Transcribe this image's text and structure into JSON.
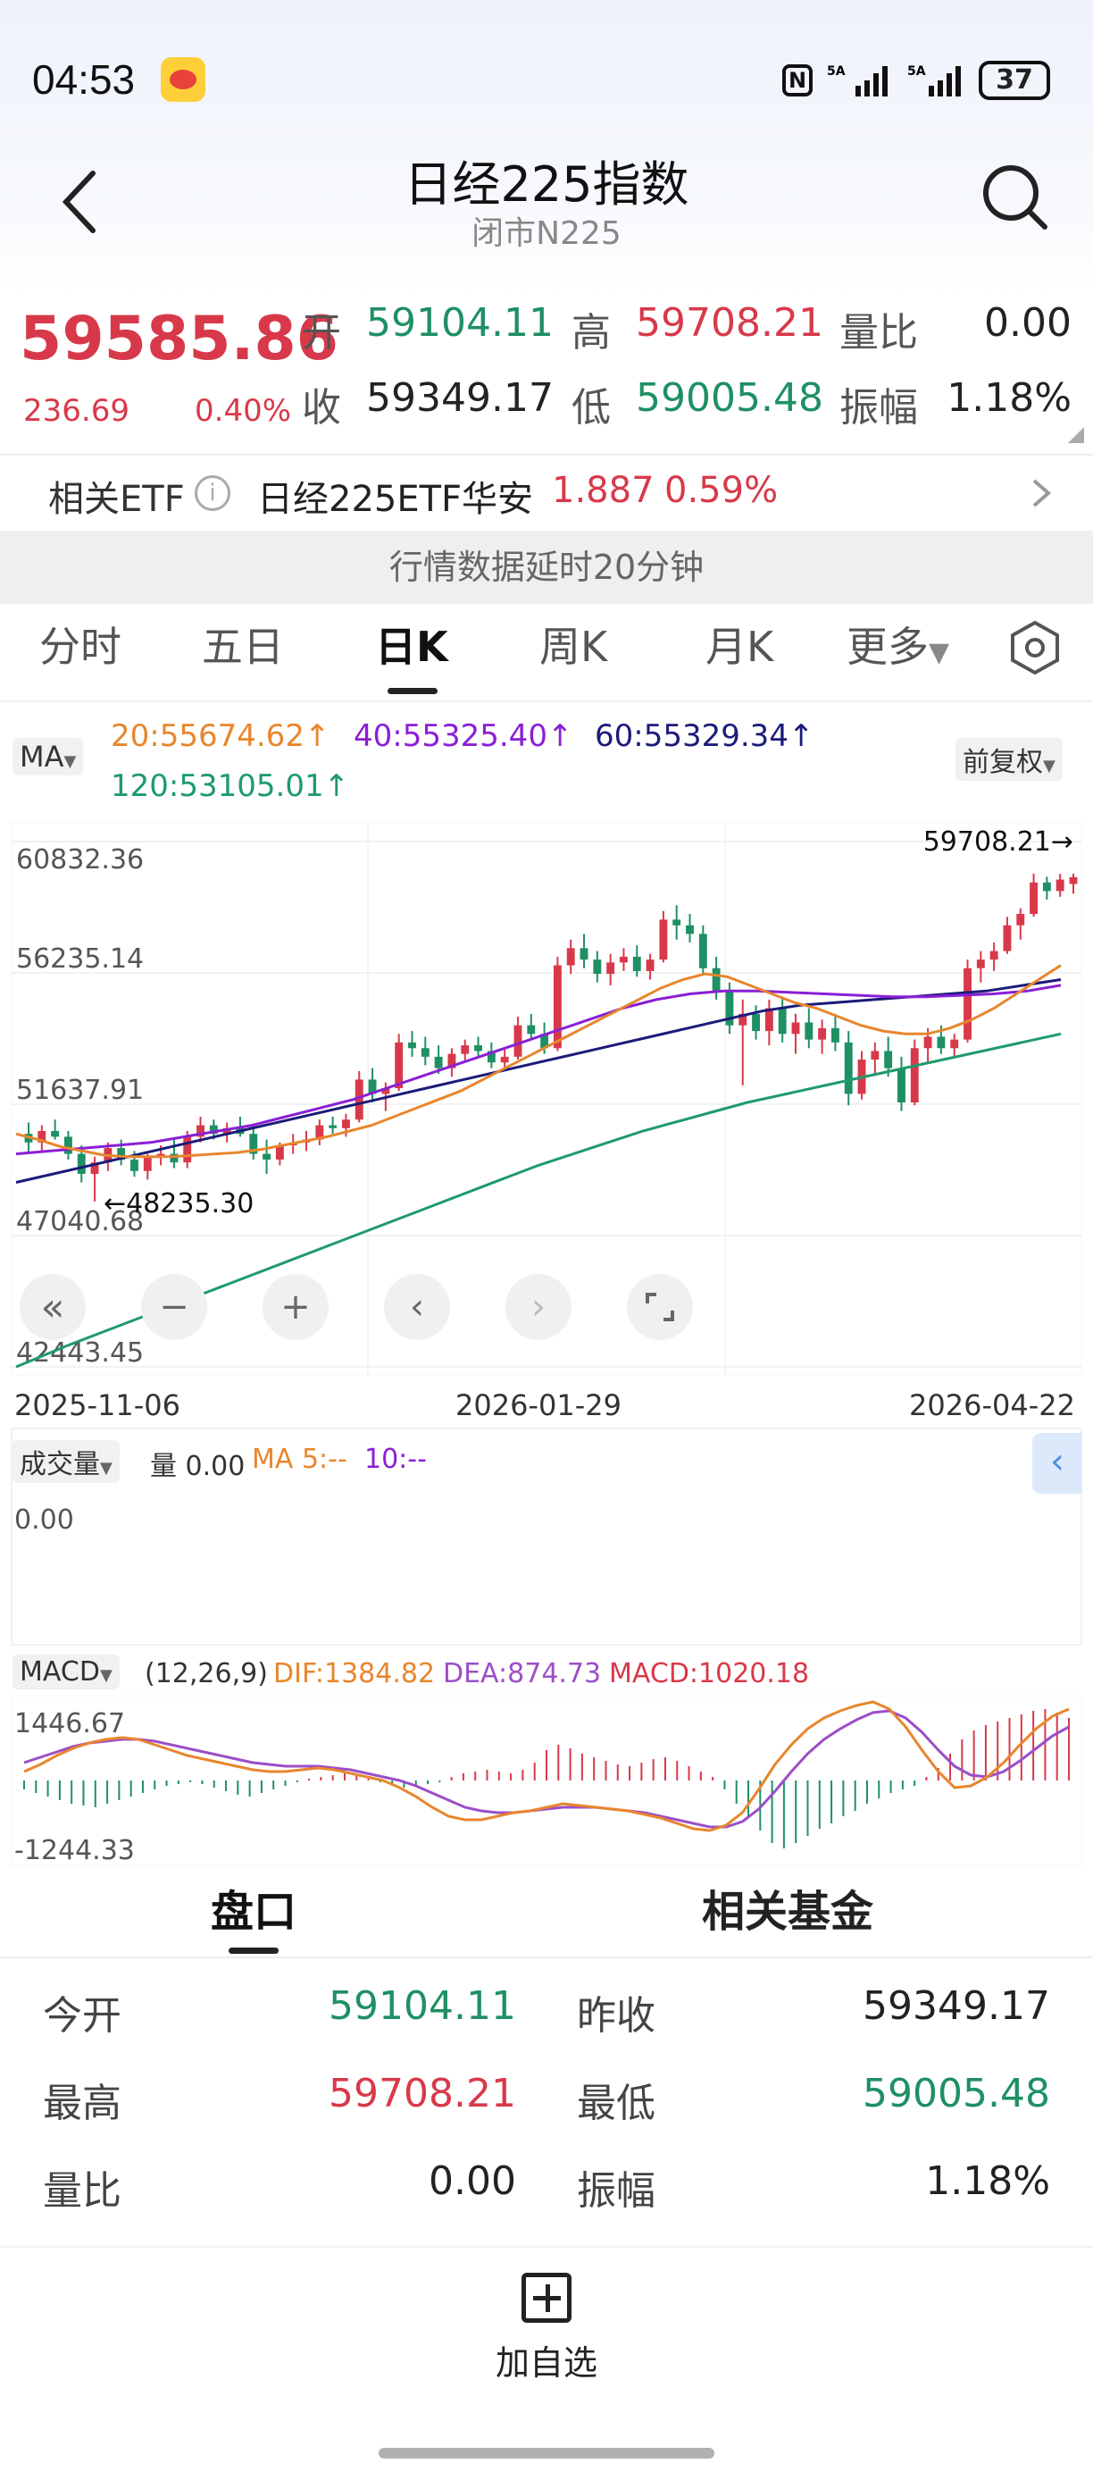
{
  "status_bar": {
    "time": "04:53",
    "battery": "37"
  },
  "header": {
    "title": "日经225指数",
    "subtitle": "闭市N225"
  },
  "quote": {
    "price": "59585.86",
    "change": "236.69",
    "change_pct": "0.40%",
    "open_label": "开",
    "open": "59104.11",
    "high_label": "高",
    "high": "59708.21",
    "ratio_label": "量比",
    "ratio": "0.00",
    "close_label": "收",
    "close": "59349.17",
    "low_label": "低",
    "low": "59005.48",
    "amp_label": "振幅",
    "amp": "1.18%"
  },
  "etf": {
    "label": "相关ETF",
    "name": "日经225ETF华安",
    "price": "1.887",
    "pct": "0.59%"
  },
  "delay_notice": "行情数据延时20分钟",
  "tabs": [
    "分时",
    "五日",
    "日K",
    "周K",
    "月K",
    "更多"
  ],
  "active_tab": "日K",
  "chart_legend": {
    "ma_button": "MA",
    "ma20": "20:55674.62↑",
    "ma40": "40:55325.40↑",
    "ma60": "60:55329.34↑",
    "ma120": "120:53105.01↑",
    "adjust_button": "前复权"
  },
  "colors": {
    "up": "#d8394a",
    "down": "#1e9063",
    "ma20": "#e8862d",
    "ma40": "#8a1fd6",
    "ma60": "#1b1b7a",
    "ma120": "#1e9a6c"
  },
  "chart_data": {
    "type": "candlestick",
    "y_ticks": [
      "60832.36",
      "56235.14",
      "51637.91",
      "47040.68",
      "42443.45"
    ],
    "ylim": [
      42443.45,
      60832.36
    ],
    "x_labels": [
      "2025-11-06",
      "2026-01-29",
      "2026-04-22"
    ],
    "max_label": "59708.21→",
    "min_label": "←48235.30",
    "ohlc": [
      [
        50600,
        51000,
        49900,
        50300
      ],
      [
        50300,
        50900,
        50000,
        50700
      ],
      [
        50700,
        51100,
        50400,
        50500
      ],
      [
        50500,
        50700,
        49700,
        49900
      ],
      [
        49900,
        50200,
        48900,
        49200
      ],
      [
        49200,
        49800,
        48235.3,
        49600
      ],
      [
        49600,
        50300,
        49300,
        50100
      ],
      [
        50100,
        50400,
        49500,
        49700
      ],
      [
        49700,
        50000,
        49100,
        49300
      ],
      [
        49300,
        49900,
        49000,
        49800
      ],
      [
        49800,
        50200,
        49500,
        49900
      ],
      [
        49900,
        50400,
        49400,
        49600
      ],
      [
        49600,
        50700,
        49400,
        50500
      ],
      [
        50500,
        51200,
        50300,
        50900
      ],
      [
        50900,
        51100,
        50400,
        50600
      ],
      [
        50600,
        51000,
        50300,
        50800
      ],
      [
        50800,
        51200,
        50500,
        50600
      ],
      [
        50600,
        50900,
        49700,
        49900
      ],
      [
        49900,
        50400,
        49200,
        49700
      ],
      [
        49700,
        50300,
        49500,
        50200
      ],
      [
        50200,
        50600,
        49900,
        50300
      ],
      [
        50300,
        50700,
        50000,
        50400
      ],
      [
        50400,
        51100,
        50200,
        50900
      ],
      [
        50900,
        51200,
        50600,
        50800
      ],
      [
        50800,
        51300,
        50500,
        51100
      ],
      [
        51100,
        52800,
        51000,
        52500
      ],
      [
        52500,
        52900,
        51700,
        52000
      ],
      [
        52000,
        52400,
        51400,
        52200
      ],
      [
        52200,
        54100,
        52100,
        53800
      ],
      [
        53800,
        54200,
        53300,
        53600
      ],
      [
        53600,
        54000,
        53000,
        53300
      ],
      [
        53300,
        53700,
        52700,
        52900
      ],
      [
        52900,
        53600,
        52600,
        53400
      ],
      [
        53400,
        53900,
        53100,
        53700
      ],
      [
        53700,
        54000,
        53300,
        53500
      ],
      [
        53500,
        53800,
        52900,
        53100
      ],
      [
        53100,
        53600,
        52800,
        53300
      ],
      [
        53300,
        54700,
        53200,
        54400
      ],
      [
        54400,
        54800,
        53900,
        54100
      ],
      [
        54100,
        54500,
        53400,
        53600
      ],
      [
        53600,
        56800,
        53500,
        56500
      ],
      [
        56500,
        57400,
        56200,
        57100
      ],
      [
        57100,
        57600,
        56400,
        56700
      ],
      [
        56700,
        57000,
        55900,
        56200
      ],
      [
        56200,
        56900,
        55800,
        56600
      ],
      [
        56600,
        57100,
        56300,
        56800
      ],
      [
        56800,
        57200,
        56100,
        56300
      ],
      [
        56300,
        56900,
        56000,
        56700
      ],
      [
        56700,
        58400,
        56600,
        58100
      ],
      [
        58100,
        58600,
        57400,
        57900
      ],
      [
        57900,
        58300,
        57300,
        57600
      ],
      [
        57600,
        57900,
        56200,
        56400
      ],
      [
        56400,
        56800,
        55300,
        55600
      ],
      [
        55600,
        55900,
        54100,
        54400
      ],
      [
        54400,
        55300,
        52300,
        54800
      ],
      [
        54800,
        55100,
        53900,
        54200
      ],
      [
        54200,
        55300,
        53700,
        55000
      ],
      [
        55000,
        55400,
        53800,
        54100
      ],
      [
        54100,
        54800,
        53400,
        54500
      ],
      [
        54500,
        55000,
        53600,
        53900
      ],
      [
        53900,
        54600,
        53400,
        54300
      ],
      [
        54300,
        54800,
        53500,
        53800
      ],
      [
        53800,
        54200,
        51600,
        52000
      ],
      [
        52000,
        53500,
        51800,
        53200
      ],
      [
        53200,
        53800,
        52700,
        53500
      ],
      [
        53500,
        54000,
        52600,
        52900
      ],
      [
        52900,
        53300,
        51400,
        51700
      ],
      [
        51700,
        53900,
        51600,
        53600
      ],
      [
        53600,
        54300,
        53100,
        54000
      ],
      [
        54000,
        54400,
        53400,
        53600
      ],
      [
        53600,
        54100,
        53300,
        53900
      ],
      [
        53900,
        56700,
        53800,
        56400
      ],
      [
        56400,
        57000,
        55900,
        56700
      ],
      [
        56700,
        57300,
        56300,
        57000
      ],
      [
        57000,
        58200,
        56900,
        57900
      ],
      [
        57900,
        58500,
        57400,
        58300
      ],
      [
        58300,
        59708.21,
        58200,
        59400
      ],
      [
        59400,
        59600,
        58800,
        59100
      ],
      [
        59100,
        59700,
        58900,
        59500
      ],
      [
        59349.17,
        59708.21,
        59005.48,
        59585.86
      ]
    ],
    "ma20": [
      50600,
      50400,
      50150,
      50000,
      49850,
      49800,
      49800,
      49800,
      49850,
      49900,
      49950,
      50050,
      50200,
      50350,
      50500,
      50700,
      50900,
      51200,
      51500,
      51800,
      52100,
      52500,
      52900,
      53300,
      53700,
      54100,
      54500,
      54900,
      55300,
      55700,
      56000,
      56200,
      56100,
      55800,
      55500,
      55200,
      55000,
      54700,
      54400,
      54200,
      54100,
      54100,
      54300,
      54600,
      55000,
      55500,
      56000,
      56500
    ],
    "ma40": [
      49900,
      50000,
      50100,
      50200,
      50300,
      50500,
      50700,
      50900,
      51200,
      51500,
      51800,
      52200,
      52600,
      53000,
      53400,
      53800,
      54200,
      54600,
      55000,
      55300,
      55500,
      55600,
      55600,
      55550,
      55500,
      55450,
      55400,
      55400,
      55450,
      55500,
      55600,
      55800
    ],
    "ma60": [
      48900,
      49200,
      49500,
      49800,
      50100,
      50400,
      50700,
      51000,
      51300,
      51600,
      51900,
      52200,
      52500,
      52800,
      53100,
      53400,
      53700,
      54000,
      54300,
      54600,
      54900,
      55100,
      55200,
      55300,
      55400,
      55500,
      55600,
      55800,
      56000
    ],
    "ma120": [
      42443,
      43200,
      43900,
      44600,
      45300,
      46000,
      46700,
      47400,
      48100,
      48800,
      49500,
      50100,
      50700,
      51200,
      51700,
      52100,
      52500,
      52900,
      53300,
      53700,
      54100
    ]
  },
  "chart_controls": {
    "icons": [
      "double-chevron-left-icon",
      "minus-icon",
      "plus-icon",
      "chevron-left-icon",
      "chevron-right-icon",
      "fullscreen-icon"
    ]
  },
  "volume_panel": {
    "label": "成交量",
    "vol": "量 0.00",
    "ma5": "MA 5:--",
    "ma10": "10:--",
    "value": "0.00"
  },
  "macd_panel": {
    "label": "MACD",
    "params": "(12,26,9)",
    "dif": "DIF:1384.82",
    "dea": "DEA:874.73",
    "macd": "MACD:1020.18",
    "top": "1446.67",
    "bottom": "-1244.33"
  },
  "section_tabs": [
    "盘口",
    "相关基金"
  ],
  "stats": {
    "open_label": "今开",
    "open": "59104.11",
    "prev_close_label": "昨收",
    "prev_close": "59349.17",
    "high_label": "最高",
    "high": "59708.21",
    "low_label": "最低",
    "low": "59005.48",
    "ratio_label": "量比",
    "ratio": "0.00",
    "amp_label": "振幅",
    "amp": "1.18%"
  },
  "add_watch": "加自选"
}
